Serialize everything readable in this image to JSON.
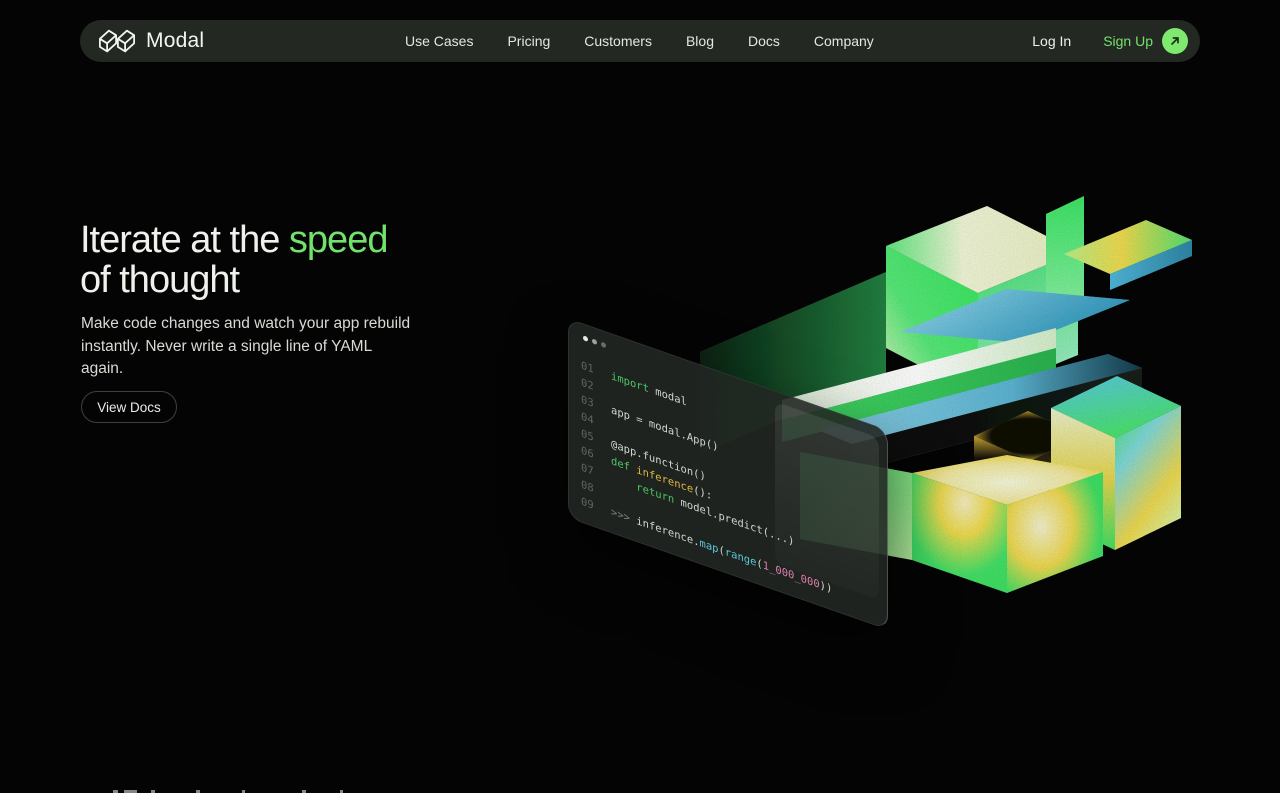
{
  "page": {
    "background": "#040404"
  },
  "nav": {
    "brand": {
      "name": "Modal"
    },
    "items": [
      {
        "label": "Use Cases"
      },
      {
        "label": "Pricing"
      },
      {
        "label": "Customers"
      },
      {
        "label": "Blog"
      },
      {
        "label": "Docs"
      },
      {
        "label": "Company"
      }
    ],
    "login_label": "Log In",
    "signup_label": "Sign Up",
    "colors": {
      "bar_bg": "#232822",
      "signup_green": "#72e26d",
      "signup_circle_bg": "#7fe96f"
    }
  },
  "hero": {
    "headline_prefix": "Iterate at the ",
    "headline_highlight": "speed",
    "headline_line2": "of thought",
    "highlight_color": "#72e26d",
    "description": "Make code changes and watch your app rebuild instantly. Never write a single line of YAML again.",
    "cta_label": "View Docs"
  },
  "code_window": {
    "traffic_lights": [
      "#e6e6e6",
      "#9aa09a",
      "#676d67"
    ],
    "colors": {
      "kw": "#4cc564",
      "fn": "#e0b73f",
      "cy": "#5bc8d8",
      "num": "#dc7fad",
      "plain": "#cfd6cf",
      "dim": "#7e867e",
      "lineno": "#5d665c"
    },
    "lines": [
      {
        "no": "01",
        "tokens": [
          {
            "t": "import"
          },
          {
            "t": " modal"
          }
        ]
      },
      {
        "no": "02",
        "tokens": []
      },
      {
        "no": "03",
        "tokens": [
          {
            "t": "app = modal.App()"
          }
        ]
      },
      {
        "no": "04",
        "tokens": []
      },
      {
        "no": "05",
        "tokens": [
          {
            "t": "@app.function()"
          }
        ]
      },
      {
        "no": "06",
        "tokens": [
          {
            "t": "def"
          },
          {
            "t": " "
          },
          {
            "t": "inference"
          },
          {
            "t": "():"
          }
        ]
      },
      {
        "no": "07",
        "tokens": [
          {
            "t": "    "
          },
          {
            "t": "return"
          },
          {
            "t": " model.predict(...)"
          }
        ]
      },
      {
        "no": "08",
        "tokens": []
      },
      {
        "no": "09",
        "tokens": [
          {
            "t": ">>> "
          },
          {
            "t": "inference."
          },
          {
            "t": "map"
          },
          {
            "t": "("
          },
          {
            "t": "range"
          },
          {
            "t": "("
          },
          {
            "t": "1_000_000"
          },
          {
            "t": "))"
          }
        ]
      }
    ]
  },
  "illustration": {
    "name": "isometric-blocks-artwork",
    "palette": {
      "green": "#3fdf63",
      "pale": "#f2f6d8",
      "yellow": "#eeda4e",
      "blue": "#6cc4de",
      "dark": "#0b0d0b"
    }
  }
}
